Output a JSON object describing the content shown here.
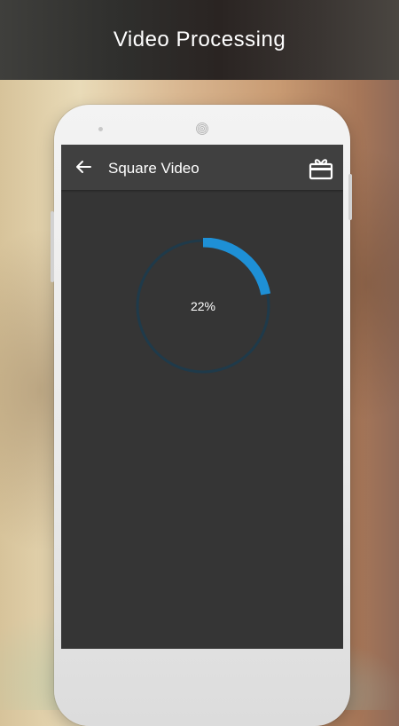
{
  "banner": {
    "title": "Video Processing"
  },
  "app": {
    "title": "Square Video",
    "back_icon": "arrow-left-icon",
    "gift_icon": "gift-icon"
  },
  "progress": {
    "fraction": 0.22,
    "label": "22%",
    "color": "#1e90d6",
    "track_color": "#1f3a4a"
  }
}
